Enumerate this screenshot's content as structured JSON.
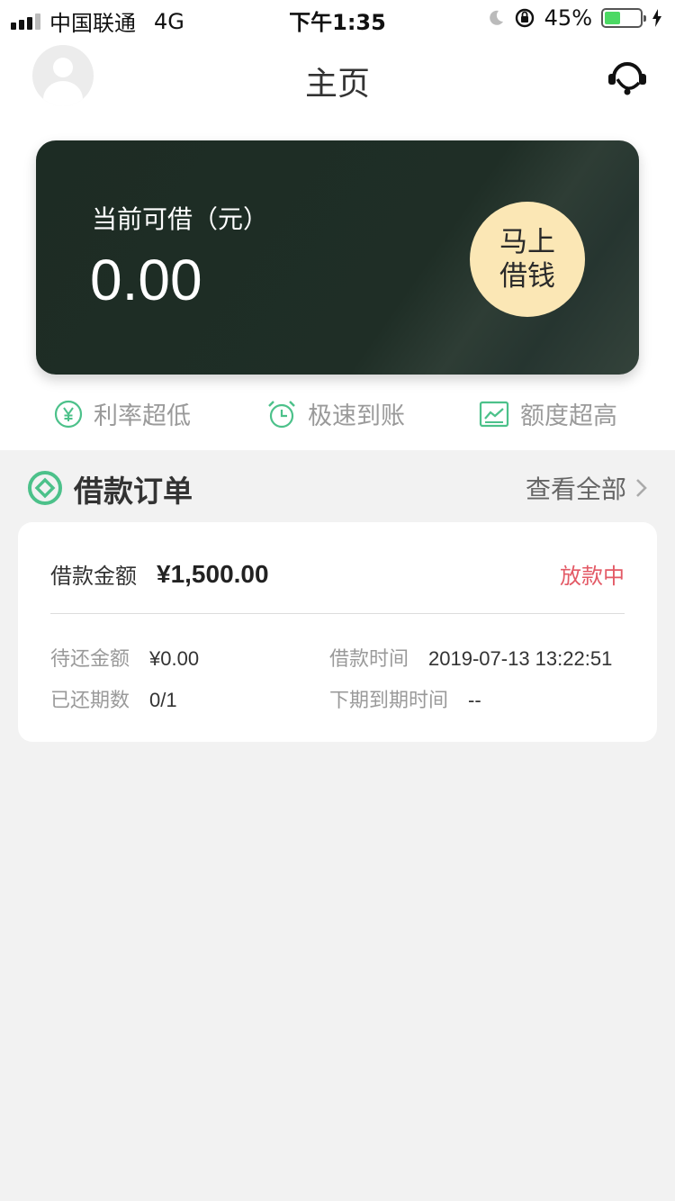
{
  "status_bar": {
    "carrier": "中国联通",
    "network": "4G",
    "time": "下午1:35",
    "battery": "45%",
    "battery_level": 0.45
  },
  "header": {
    "title": "主页"
  },
  "card": {
    "label": "当前可借（元）",
    "amount": "0.00",
    "button_line1": "马上",
    "button_line2": "借钱"
  },
  "features": [
    {
      "label": "利率超低",
      "icon": "yen-circle-icon"
    },
    {
      "label": "极速到账",
      "icon": "alarm-clock-icon"
    },
    {
      "label": "额度超高",
      "icon": "chart-icon"
    }
  ],
  "orders": {
    "title": "借款订单",
    "view_all": "查看全部",
    "item": {
      "amount_label": "借款金额",
      "amount": "¥1,500.00",
      "status": "放款中",
      "pending_label": "待还金额",
      "pending_value": "¥0.00",
      "time_label": "借款时间",
      "time_value": "2019-07-13 13:22:51",
      "periods_label": "已还期数",
      "periods_value": "0/1",
      "next_due_label": "下期到期时间",
      "next_due_value": "--"
    }
  },
  "colors": {
    "accent_green": "#4cc18a",
    "card_bg": "#1f2e26",
    "button_bg": "#fbe7b5",
    "status_red": "#e35a66"
  }
}
